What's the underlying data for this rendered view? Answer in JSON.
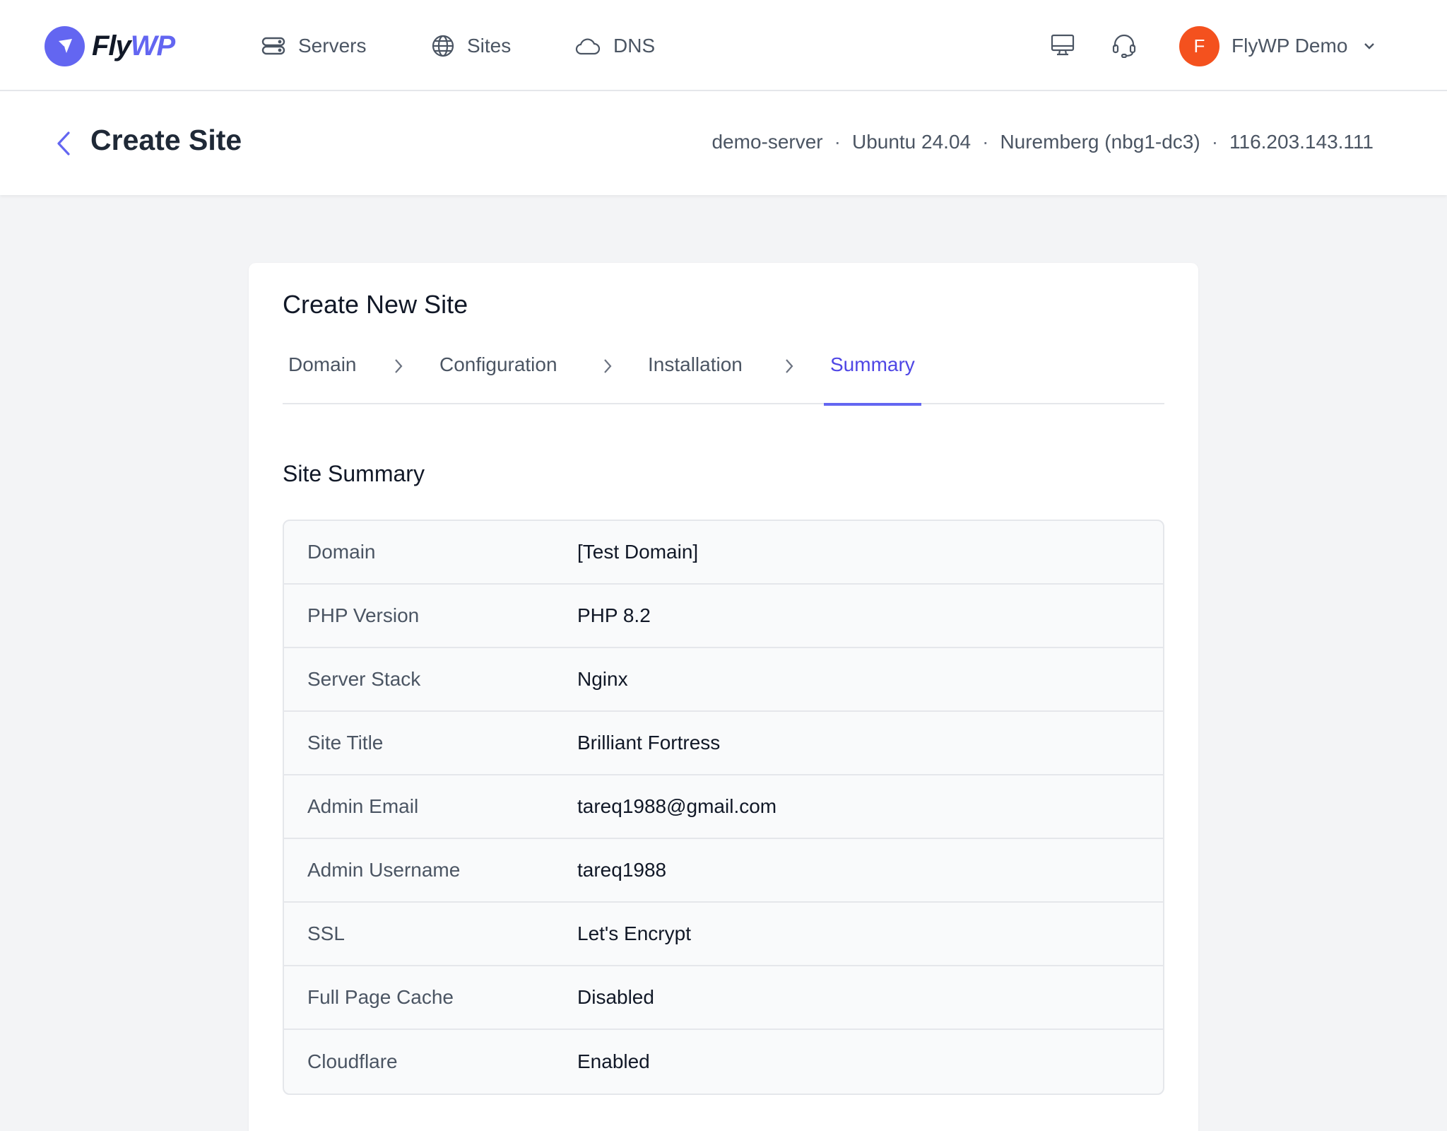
{
  "brand": {
    "name_part1": "Fly",
    "name_part2": "WP"
  },
  "nav": {
    "servers": "Servers",
    "sites": "Sites",
    "dns": "DNS"
  },
  "user": {
    "initial": "F",
    "name": "FlyWP Demo"
  },
  "header": {
    "title": "Create Site",
    "server_name": "demo-server",
    "os": "Ubuntu 24.04",
    "location": "Nuremberg (nbg1-dc3)",
    "ip": "116.203.143.111",
    "separator": "·"
  },
  "card": {
    "title": "Create New Site",
    "steps": [
      {
        "label": "Domain"
      },
      {
        "label": "Configuration"
      },
      {
        "label": "Installation"
      },
      {
        "label": "Summary"
      }
    ],
    "active_step": "Summary",
    "section_title": "Site Summary",
    "summary": [
      {
        "label": "Domain",
        "value": "[Test Domain]"
      },
      {
        "label": "PHP Version",
        "value": "PHP 8.2"
      },
      {
        "label": "Server Stack",
        "value": "Nginx"
      },
      {
        "label": "Site Title",
        "value": "Brilliant Fortress"
      },
      {
        "label": "Admin Email",
        "value": "tareq1988@gmail.com"
      },
      {
        "label": "Admin Username",
        "value": "tareq1988"
      },
      {
        "label": "SSL",
        "value": "Let's Encrypt"
      },
      {
        "label": "Full Page Cache",
        "value": "Disabled"
      },
      {
        "label": "Cloudflare",
        "value": "Enabled"
      }
    ]
  },
  "colors": {
    "accent": "#6366f1",
    "avatar": "#f4511e",
    "background": "#f3f4f6"
  },
  "icons": [
    "logo-icon",
    "server-icon",
    "globe-icon",
    "cloud-icon",
    "monitor-icon",
    "headset-icon",
    "chevron-down-icon",
    "back-arrow-icon",
    "chevron-right-icon"
  ]
}
